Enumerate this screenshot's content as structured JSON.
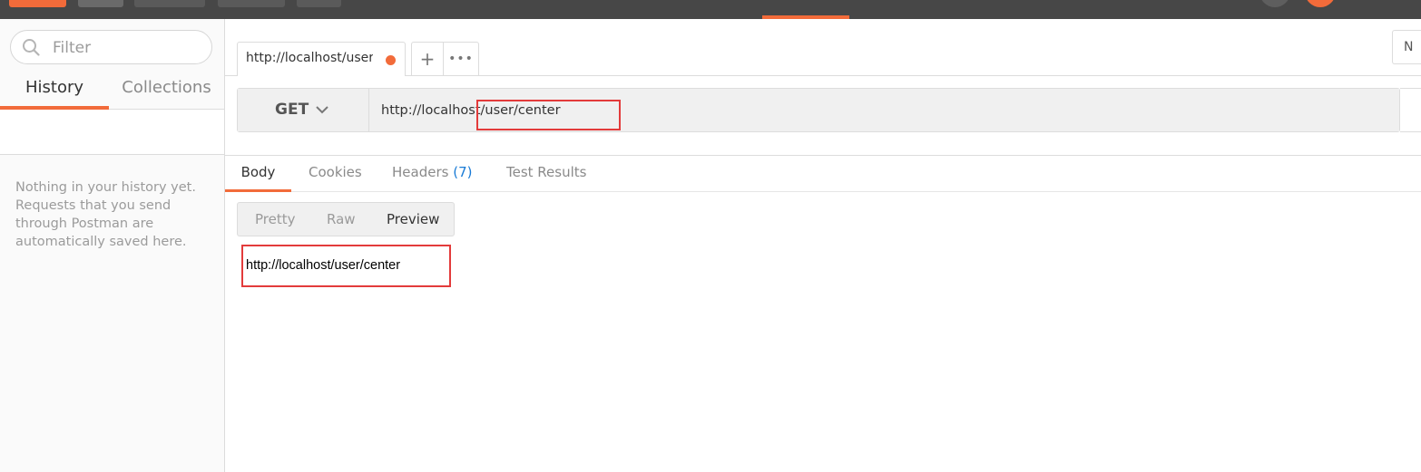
{
  "sidebar": {
    "search": {
      "placeholder": "Filter"
    },
    "tabs": [
      {
        "label": "History"
      },
      {
        "label": "Collections"
      }
    ],
    "empty_message": "Nothing in your history yet. Requests that you send through Postman are automatically saved here."
  },
  "request_tab": {
    "label": "http://localhost/user/center",
    "add_label": "+",
    "more_label": "•••"
  },
  "environment": {
    "visible_text": "N"
  },
  "request": {
    "method": "GET",
    "url": "http://localhost/user/center"
  },
  "response": {
    "tabs": {
      "body": "Body",
      "cookies": "Cookies",
      "headers": "Headers",
      "headers_count": "(7)",
      "tests": "Test Results"
    },
    "view_modes": {
      "pretty": "Pretty",
      "raw": "Raw",
      "preview": "Preview"
    },
    "preview_content": "http://localhost/user/center"
  },
  "colors": {
    "accent": "#f26b3a",
    "highlight_box": "#e33b3b",
    "link_count": "#1a7bd6"
  }
}
